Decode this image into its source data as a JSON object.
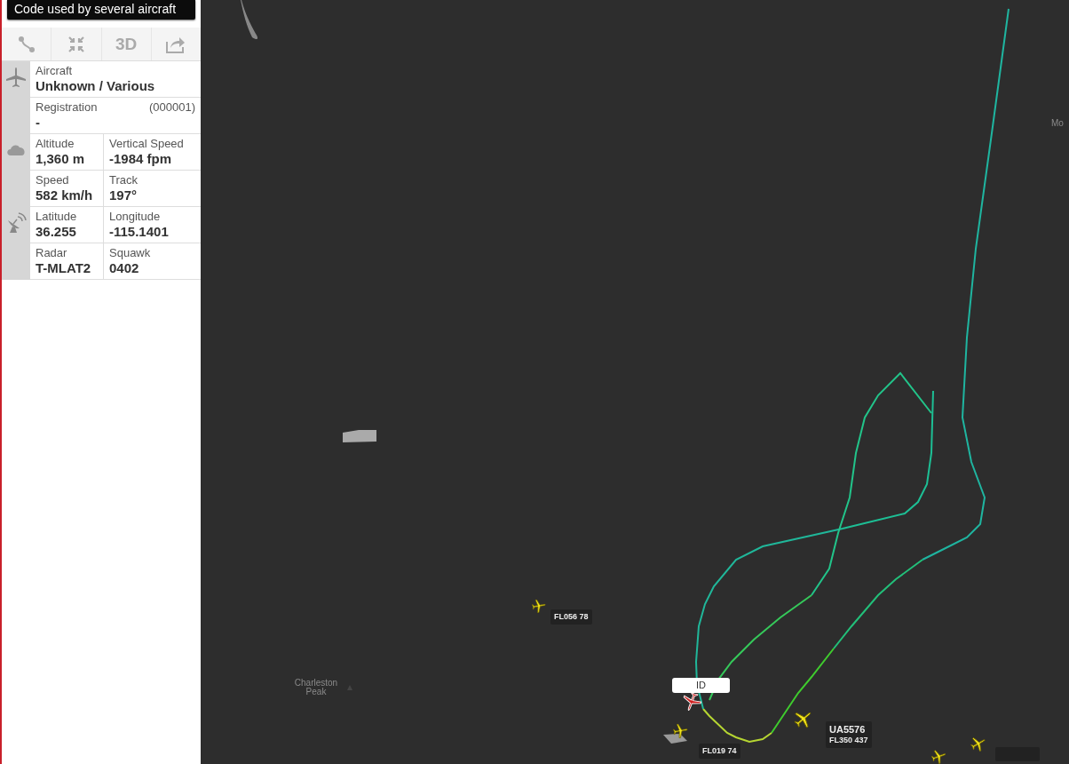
{
  "notice": "Code used by several aircraft",
  "toolbar": [
    {
      "kind": "route"
    },
    {
      "kind": "collapse"
    },
    {
      "kind": "text",
      "label": "3D"
    },
    {
      "kind": "share"
    }
  ],
  "sections": [
    {
      "kind": "aircraft",
      "rows": [
        [
          {
            "label": "Aircraft",
            "value": "Unknown / Various"
          }
        ],
        [
          {
            "label": "Registration",
            "note": "(000001)",
            "value": "-"
          }
        ]
      ]
    },
    {
      "kind": "weather",
      "rows": [
        [
          {
            "label": "Altitude",
            "value": "1,360 m"
          },
          {
            "label": "Vertical Speed",
            "value": "-1984 fpm"
          }
        ],
        [
          {
            "label": "Speed",
            "value": "582 km/h"
          },
          {
            "label": "Track",
            "value": "197°"
          }
        ]
      ]
    },
    {
      "kind": "radar",
      "rows": [
        [
          {
            "label": "Latitude",
            "value": "36.255"
          },
          {
            "label": "Longitude",
            "value": "-115.1401"
          }
        ],
        [
          {
            "label": "Radar",
            "value": "T-MLAT2"
          },
          {
            "label": "Squawk",
            "value": "0402"
          }
        ]
      ]
    }
  ],
  "map": {
    "places": [
      "Charleston Peak",
      "Mo"
    ],
    "traffic": [
      {
        "selected": false,
        "lines": [
          "FL056 78"
        ]
      },
      {
        "selected": true,
        "tooltip": "ID"
      },
      {
        "selected": false,
        "lines": [
          "FL019 74"
        ]
      },
      {
        "selected": false,
        "lines": [
          "UA5576",
          "FL350 437"
        ]
      },
      {
        "selected": false
      },
      {
        "selected": false
      }
    ]
  }
}
